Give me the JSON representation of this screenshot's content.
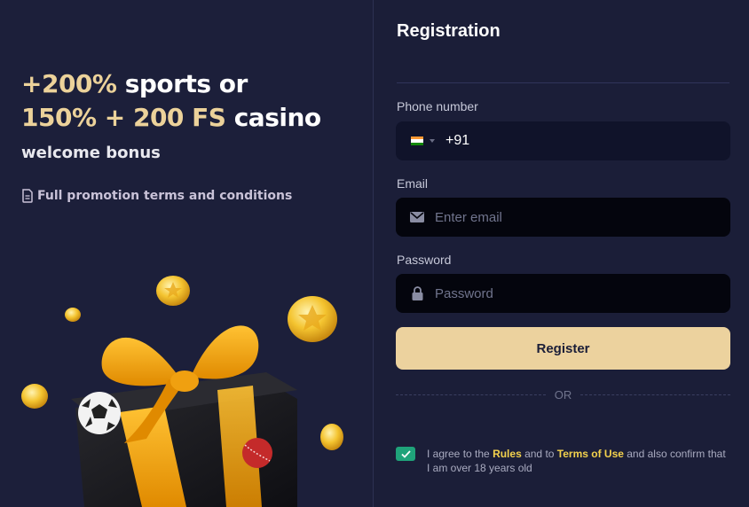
{
  "promo": {
    "line1_highlight": "+200%",
    "line1_rest": " sports or",
    "line2_highlight": "150% + 200 FS",
    "line2_rest": " casino",
    "subtitle": "welcome bonus",
    "terms_link": "Full promotion terms and conditions",
    "terms_icon": "document-icon"
  },
  "registration": {
    "title": "Registration",
    "phone": {
      "label": "Phone number",
      "country_flag": "india-flag-icon",
      "code": "+91"
    },
    "email": {
      "label": "Email",
      "placeholder": "Enter email",
      "icon": "envelope-icon"
    },
    "password": {
      "label": "Password",
      "placeholder": "Password",
      "icon": "lock-icon"
    },
    "register_label": "Register",
    "or_label": "OR",
    "agreement": {
      "checked": true,
      "prefix": "I agree to the ",
      "rules_link": "Rules",
      "middle": " and to ",
      "terms_link": "Terms of Use",
      "suffix": " and also confirm that I am over 18 years old"
    }
  },
  "colors": {
    "accent_gold": "#ecd29e",
    "link_yellow": "#f4d24d",
    "checkbox_green": "#1fa37a",
    "background": "#1c1f3a"
  }
}
